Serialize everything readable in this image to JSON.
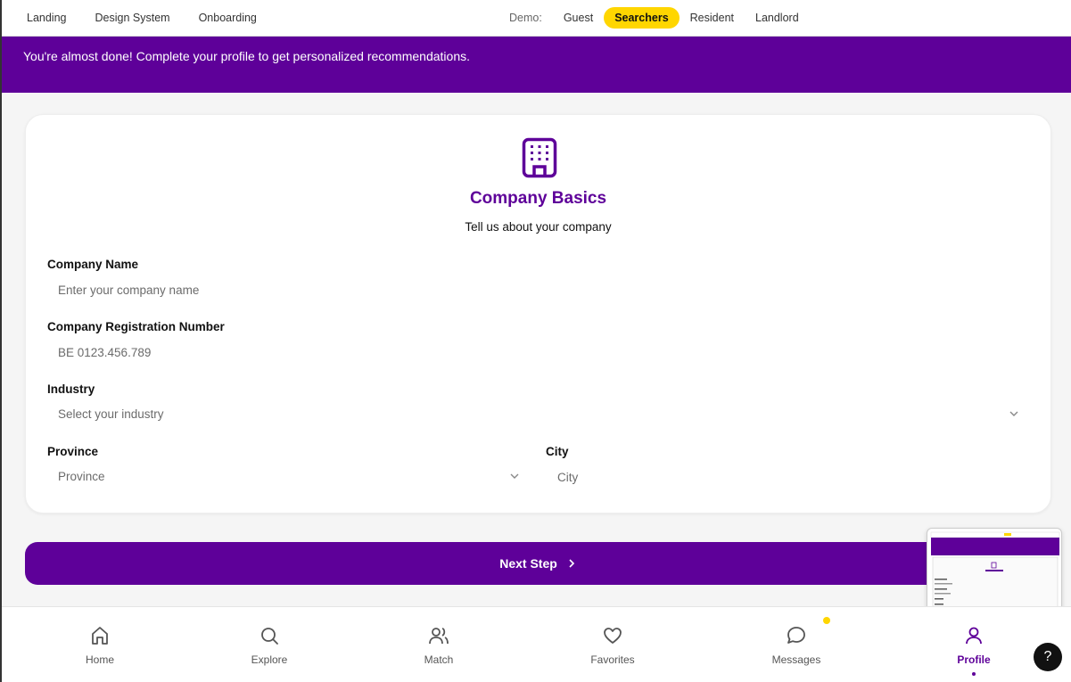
{
  "topnav": {
    "links": [
      "Landing",
      "Design System",
      "Onboarding"
    ],
    "demo_label": "Demo:",
    "demo_roles": [
      "Guest",
      "Searchers",
      "Resident",
      "Landlord"
    ],
    "active_role": "Searchers"
  },
  "banner": {
    "text": "You're almost done! Complete your profile to get personalized recommendations."
  },
  "card": {
    "icon": "building-icon",
    "title": "Company Basics",
    "subtitle": "Tell us about your company",
    "fields": {
      "company_name": {
        "label": "Company Name",
        "placeholder": "Enter your company name",
        "value": ""
      },
      "registration": {
        "label": "Company Registration Number",
        "placeholder": "BE 0123.456.789",
        "value": ""
      },
      "industry": {
        "label": "Industry",
        "placeholder": "Select your industry"
      },
      "province": {
        "label": "Province",
        "placeholder": "Province"
      },
      "city": {
        "label": "City",
        "placeholder": "City",
        "value": ""
      }
    }
  },
  "next_button": {
    "label": "Next Step"
  },
  "bottomnav": {
    "items": [
      {
        "label": "Home",
        "icon": "home-icon"
      },
      {
        "label": "Explore",
        "icon": "search-icon"
      },
      {
        "label": "Match",
        "icon": "users-icon"
      },
      {
        "label": "Favorites",
        "icon": "heart-icon"
      },
      {
        "label": "Messages",
        "icon": "message-icon"
      },
      {
        "label": "Profile",
        "icon": "user-icon"
      }
    ],
    "active": "Profile"
  },
  "help": {
    "label": "?"
  },
  "colors": {
    "brand": "#5e0099",
    "accent": "#ffd600"
  }
}
